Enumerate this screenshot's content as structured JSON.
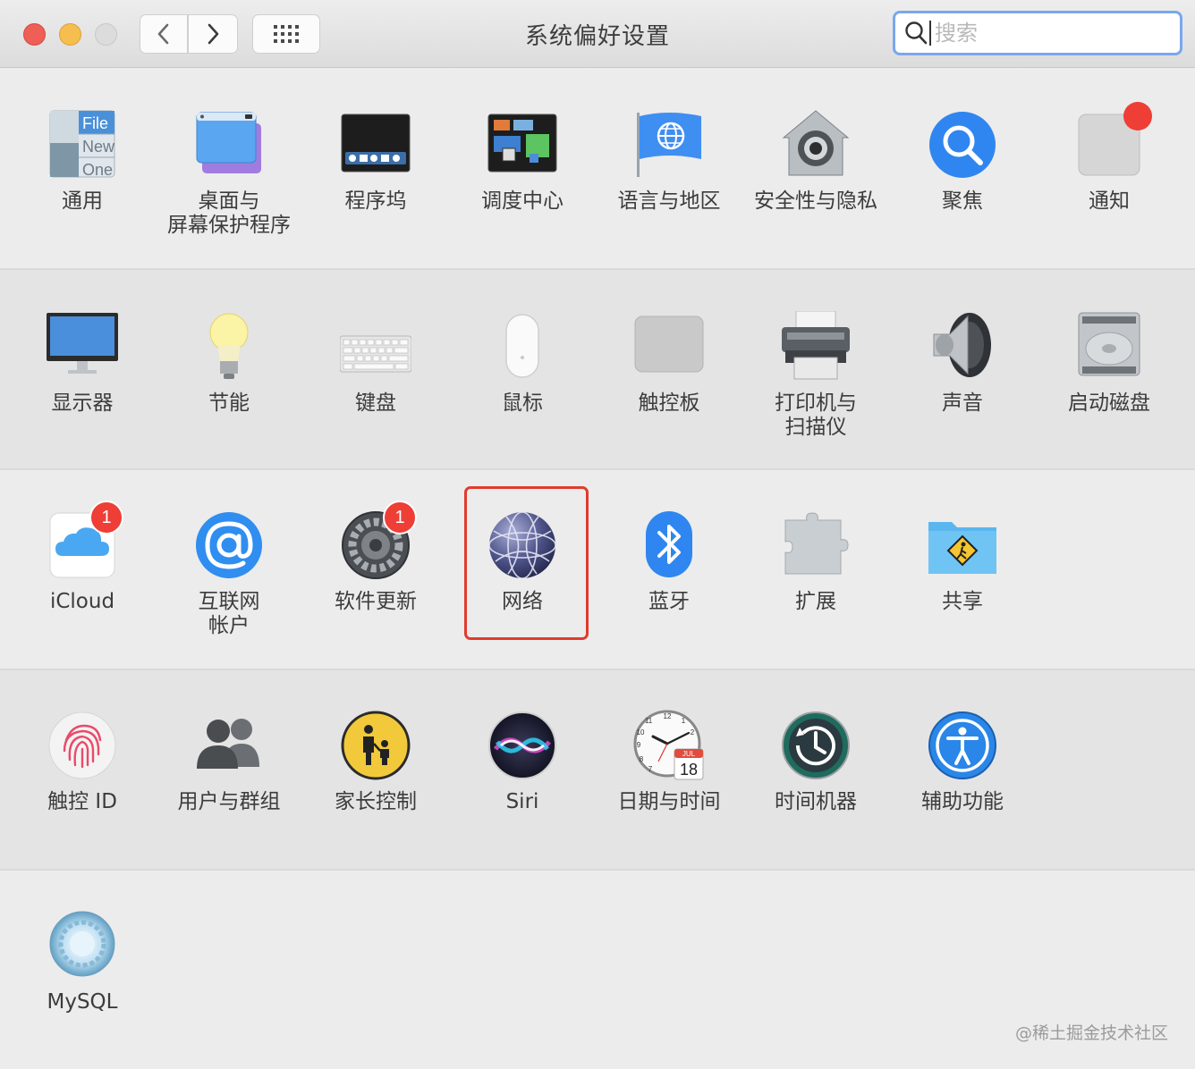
{
  "window": {
    "title": "系统偏好设置"
  },
  "search": {
    "placeholder": "搜索"
  },
  "sections": [
    {
      "items": [
        {
          "label": "通用"
        },
        {
          "label": "桌面与\n屏幕保护程序"
        },
        {
          "label": "程序坞"
        },
        {
          "label": "调度中心"
        },
        {
          "label": "语言与地区"
        },
        {
          "label": "安全性与隐私"
        },
        {
          "label": "聚焦"
        },
        {
          "label": "通知"
        }
      ]
    },
    {
      "items": [
        {
          "label": "显示器"
        },
        {
          "label": "节能"
        },
        {
          "label": "键盘"
        },
        {
          "label": "鼠标"
        },
        {
          "label": "触控板"
        },
        {
          "label": "打印机与\n扫描仪"
        },
        {
          "label": "声音"
        },
        {
          "label": "启动磁盘"
        }
      ]
    },
    {
      "items": [
        {
          "label": "iCloud",
          "badge": "1"
        },
        {
          "label": "互联网\n帐户"
        },
        {
          "label": "软件更新",
          "badge": "1"
        },
        {
          "label": "网络"
        },
        {
          "label": "蓝牙"
        },
        {
          "label": "扩展"
        },
        {
          "label": "共享"
        }
      ]
    },
    {
      "items": [
        {
          "label": "触控 ID"
        },
        {
          "label": "用户与群组"
        },
        {
          "label": "家长控制"
        },
        {
          "label": "Siri"
        },
        {
          "label": "日期与时间"
        },
        {
          "label": "时间机器"
        },
        {
          "label": "辅助功能"
        }
      ]
    },
    {
      "items": [
        {
          "label": "MySQL"
        }
      ]
    }
  ],
  "icon_text": {
    "general_file": "File",
    "general_new": "New",
    "general_one": "One",
    "calendar_month": "JUL",
    "calendar_day": "18"
  },
  "watermark": "@稀土掘金技术社区",
  "colors": {
    "highlight": "#e03b2e",
    "search_focus": "#7aa7ee",
    "badge": "#ee3e36"
  }
}
